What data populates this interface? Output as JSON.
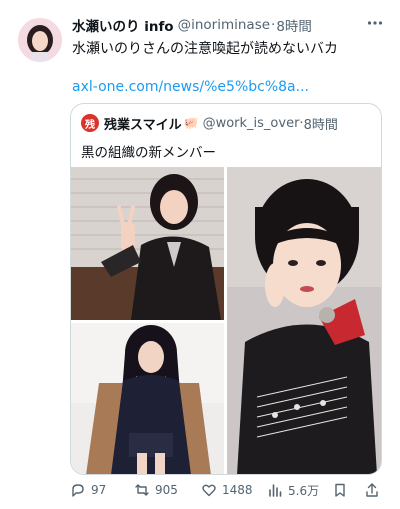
{
  "tweet": {
    "author_name": "水瀬いのり info",
    "handle": "@inoriminase",
    "separator": "·",
    "time": "8時間",
    "text": "水瀬いのりさんの注意喚起が読めないバカ",
    "link": "axl-one.com/news/%e5%bc%8a..."
  },
  "quoted_tweet": {
    "avatar_text": "残",
    "author_name": "残業スマイル",
    "emoji": "🐖",
    "handle": "@work_is_over",
    "separator": "·",
    "time": "8時間",
    "text": "黒の組織の新メンバー"
  },
  "actions": {
    "replies": "97",
    "retweets": "905",
    "likes": "1488",
    "views": "5.6万"
  },
  "colors": {
    "link": "#1d9bf0",
    "muted": "#536471",
    "border": "#cfd9de",
    "quote_avatar": "#d8332c"
  },
  "icons": [
    "more-icon",
    "reply-icon",
    "retweet-icon",
    "like-icon",
    "views-icon",
    "bookmark-icon",
    "share-icon"
  ]
}
